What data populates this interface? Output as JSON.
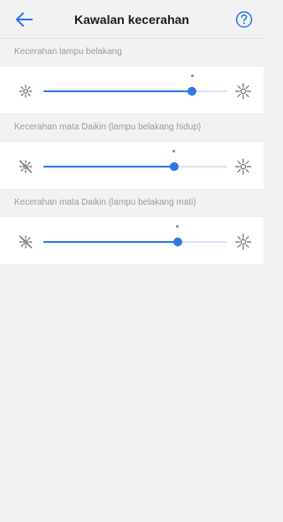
{
  "header": {
    "title": "Kawalan kecerahan",
    "back_icon": "arrow-left-icon",
    "help_icon": "help-circle-icon",
    "accent": "#2f76e4"
  },
  "sliders": [
    {
      "label": "Kecerahan lampu belakang",
      "value": 0.81,
      "left_icon": "sun-dim-icon",
      "right_icon": "sun-bright-icon"
    },
    {
      "label": "Kecerahan mata Daikin (lampu belakang hidup)",
      "value": 0.71,
      "left_icon": "sun-off-icon",
      "right_icon": "sun-bright-icon"
    },
    {
      "label": "Kecerahan mata Daikin (lampu belakang mati)",
      "value": 0.73,
      "left_icon": "sun-off-icon",
      "right_icon": "sun-bright-icon"
    }
  ]
}
